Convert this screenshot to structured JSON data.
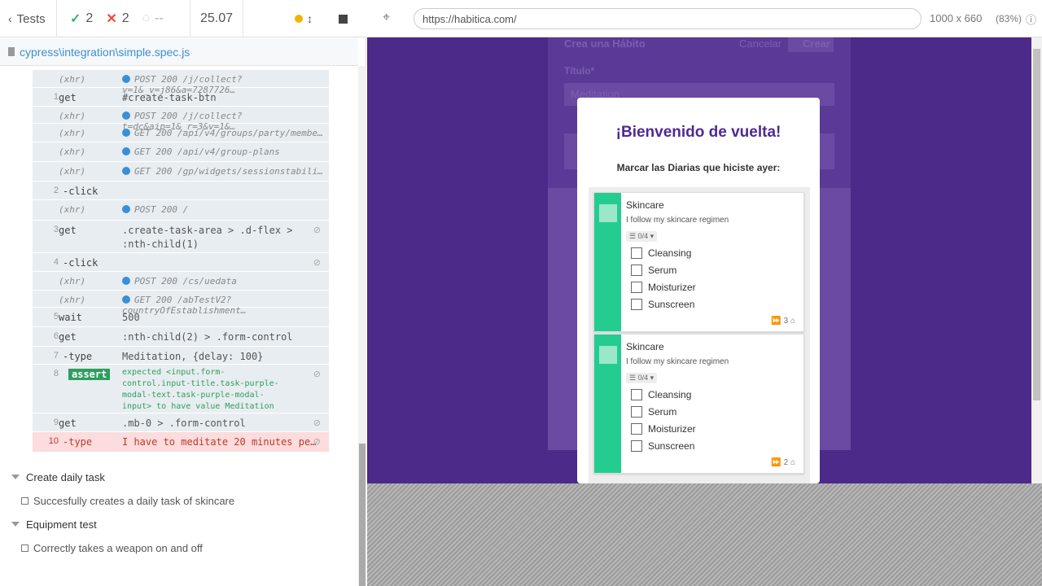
{
  "topbar": {
    "tests_label": "Tests",
    "passed": "2",
    "failed": "2",
    "pending": "--",
    "duration": "25.07"
  },
  "spec_file": "cypress\\integration\\simple.spec.js",
  "commands": [
    {
      "num": "",
      "cmd": "(xhr)",
      "msg": "POST 200 /j/collect?v=1&_v=j86&a=7287726…",
      "xhr": true,
      "dot": true
    },
    {
      "num": "1",
      "cmd": "get",
      "msg": "#create-task-btn"
    },
    {
      "num": "",
      "cmd": "(xhr)",
      "msg": "POST 200 /j/collect?t=dc&aip=1&_r=3&v=1&…",
      "xhr": true,
      "dot": true
    },
    {
      "num": "",
      "cmd": "(xhr)",
      "msg": "GET 200 /api/v4/groups/party/membe…",
      "xhr": true,
      "dot": true
    },
    {
      "num": "",
      "cmd": "(xhr)",
      "msg": "GET 200 /api/v4/group-plans",
      "xhr": true,
      "dot": true
    },
    {
      "num": "",
      "cmd": "(xhr)",
      "msg": "GET 200 /gp/widgets/sessionstabili…",
      "xhr": true,
      "dot": true
    },
    {
      "num": "2",
      "cmd": "-click",
      "msg": ""
    },
    {
      "num": "",
      "cmd": "(xhr)",
      "msg": "POST 200 /",
      "xhr": true,
      "dot": true
    },
    {
      "num": "3",
      "cmd": "get",
      "msg": ".create-task-area > .d-flex >",
      "msg2": ":nth-child(1)",
      "eye": true
    },
    {
      "num": "4",
      "cmd": "-click",
      "msg": "",
      "eye": true
    },
    {
      "num": "",
      "cmd": "(xhr)",
      "msg": "POST 200 /cs/uedata",
      "xhr": true,
      "dot": true
    },
    {
      "num": "",
      "cmd": "(xhr)",
      "msg": "GET 200 /abTestV2?countryOfEstablishment…",
      "xhr": true,
      "dot": true
    },
    {
      "num": "5",
      "cmd": "wait",
      "msg": "500"
    },
    {
      "num": "6",
      "cmd": "get",
      "msg": ":nth-child(2) > .form-control"
    },
    {
      "num": "7",
      "cmd": "-type",
      "msg": "Meditation, {delay: 100}"
    },
    {
      "num": "8",
      "cmd": "assert",
      "msg": "expected <input.form-control.input-title.task-purple-modal-text.task-purple-modal-input> to have value Meditation",
      "eye": true
    },
    {
      "num": "9",
      "cmd": "get",
      "msg": ".mb-0 > .form-control",
      "eye": true
    },
    {
      "num": "10",
      "cmd": "-type",
      "msg": "I have to meditate 20 minutes pe…",
      "eye": true,
      "err": true
    }
  ],
  "suites": [
    {
      "title": "Create daily task",
      "test": "Succesfully creates a daily task of skincare"
    },
    {
      "title": "Equipment test",
      "test": "Correctly takes a weapon on and off"
    }
  ],
  "browser": {
    "url": "https://habitica.com/",
    "viewport": "1000 x 660",
    "zoom": "(83%)"
  },
  "bg": {
    "title": "Crea una Hábito",
    "cancel": "Cancelar",
    "create": "Crear",
    "field": "Título*",
    "value": "Meditation"
  },
  "modal": {
    "title": "¡Bienvenido de vuelta!",
    "subtitle": "Marcar las Diarias que hiciste ayer:",
    "tasks": [
      {
        "name": "Skincare",
        "note": "I follow my skincare regimen",
        "badge": "0/4",
        "items": [
          "Cleansing",
          "Serum",
          "Moisturizer",
          "Sunscreen"
        ],
        "streak": "3"
      },
      {
        "name": "Skincare",
        "note": "I follow my skincare regimen",
        "badge": "0/4",
        "items": [
          "Cleansing",
          "Serum",
          "Moisturizer",
          "Sunscreen"
        ],
        "streak": "2"
      }
    ]
  },
  "colors": {
    "passed": "#3cb371",
    "failed": "#e74c3c",
    "habitica_purple": "#4b2a8a",
    "task_green": "#24cc8f"
  }
}
